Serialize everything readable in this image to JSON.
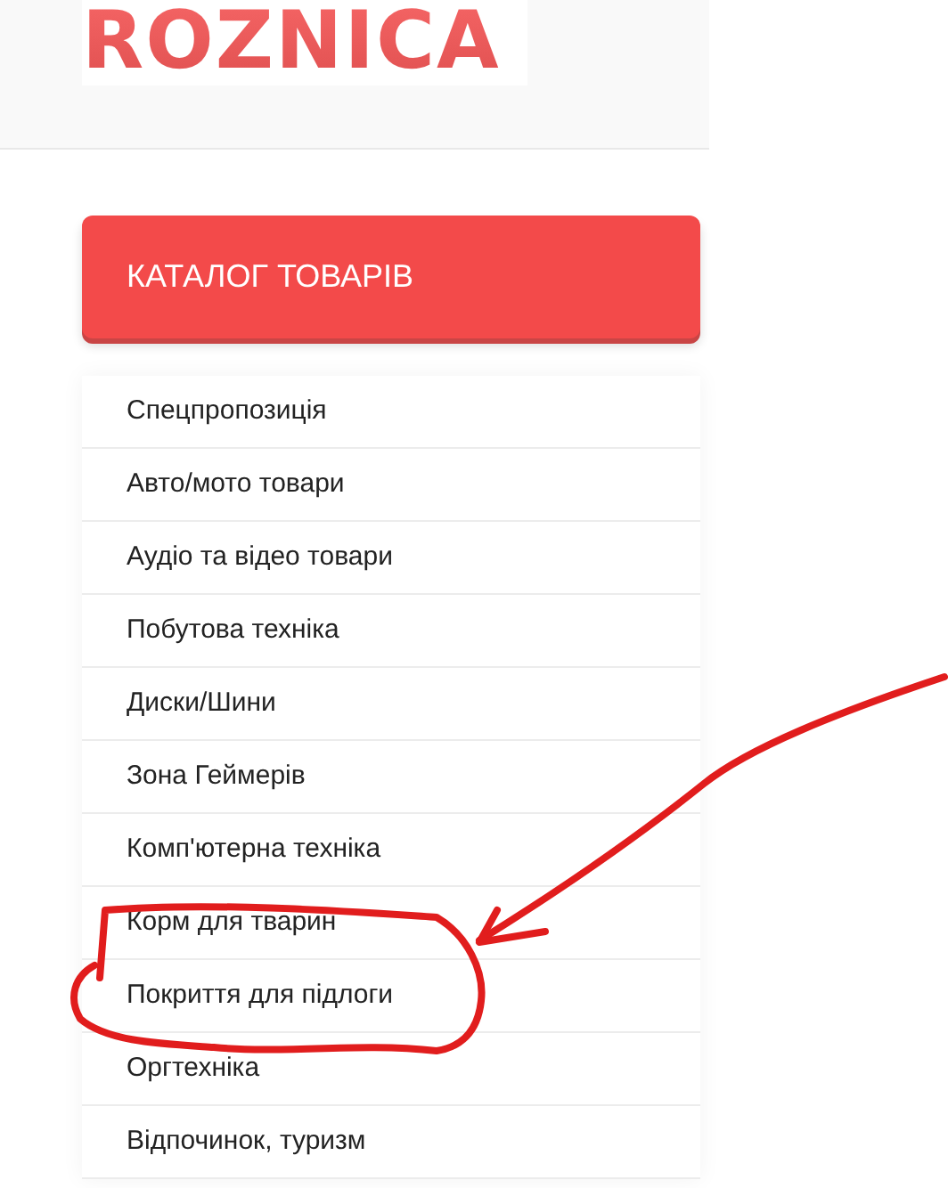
{
  "header": {
    "logo": "ROZNICA"
  },
  "catalog_button": {
    "label": "КАТАЛОГ ТОВАРІВ"
  },
  "categories": [
    {
      "label": "Спецпропозиція"
    },
    {
      "label": "Авто/мото товари"
    },
    {
      "label": "Аудіо та відео товари"
    },
    {
      "label": "Побутова техніка"
    },
    {
      "label": "Диски/Шини"
    },
    {
      "label": "Зона Геймерів"
    },
    {
      "label": "Комп'ютерна техніка"
    },
    {
      "label": "Корм для тварин"
    },
    {
      "label": "Покриття для підлоги"
    },
    {
      "label": "Оргтехніка"
    },
    {
      "label": "Відпочинок, туризм"
    }
  ]
}
